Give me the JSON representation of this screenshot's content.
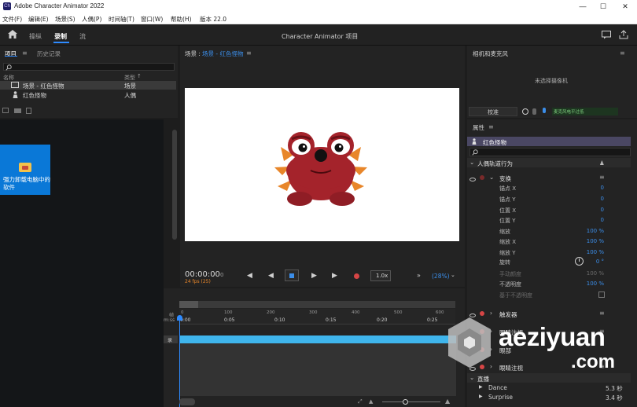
{
  "window": {
    "title": "Adobe Character Animator 2022",
    "icon": "Ch"
  },
  "menu": [
    "文件(F)",
    "编辑(E)",
    "场景(S)",
    "人偶(P)",
    "时间轴(T)",
    "窗口(W)",
    "帮助(H)",
    "版本 22.0"
  ],
  "header": {
    "tabs": [
      "操纵",
      "录制",
      "流"
    ],
    "active_tab": "录制",
    "project_title": "Character Animator 项目"
  },
  "project": {
    "tabs": [
      "项目",
      "历史记录"
    ],
    "col_name": "名称",
    "col_type": "类型",
    "items": [
      {
        "name": "场景 - 红色怪物",
        "type": "场景"
      },
      {
        "name": "红色怪物",
        "type": "人偶"
      }
    ]
  },
  "desktop": {
    "label": "强力卸载电脑中的软件"
  },
  "scene": {
    "title_prefix": "场景 : ",
    "title_name": "场景 - 红色怪物",
    "timecode": "00:00:00",
    "frame": "0",
    "fps": "24 fps (25)",
    "speed": "1.0x",
    "zoom": "(28%)"
  },
  "timeline": {
    "frames_label": "帧",
    "secs_label": "m:ss",
    "frame_ticks": [
      "0",
      "100",
      "200",
      "300",
      "400",
      "500",
      "600"
    ],
    "time_ticks": [
      "0:00",
      "0:05",
      "0:10",
      "0:15",
      "0:20",
      "0:25"
    ],
    "track_label": "录"
  },
  "camera": {
    "title": "相机和麦克风",
    "status": "未选择摄像机",
    "calibrate": "校准",
    "mic_status": "麦克风电平过低"
  },
  "properties": {
    "title": "属性",
    "puppet": "红色怪物",
    "section": "人偶轨道行为",
    "transform": "变换",
    "rows": [
      {
        "label": "锚点 X",
        "value": "0"
      },
      {
        "label": "锚点 Y",
        "value": "0"
      },
      {
        "label": "位置 X",
        "value": "0"
      },
      {
        "label": "位置 Y",
        "value": "0"
      },
      {
        "label": "缩放",
        "value": "100 %"
      },
      {
        "label": "缩放 X",
        "value": "100 %"
      },
      {
        "label": "缩放 Y",
        "value": "100 %"
      },
      {
        "label": "旋转",
        "value": "0 °"
      },
      {
        "label": "手动颜度",
        "value": "100 %"
      },
      {
        "label": "不透明度",
        "value": "100 %"
      },
      {
        "label": "基于不透明度",
        "value": ""
      }
    ],
    "behaviors": [
      "触发器",
      "眼睛注视",
      "眼部",
      "眼睛注视"
    ],
    "live_title": "直播",
    "live": [
      {
        "name": "Dance",
        "value": "5.3 秒"
      },
      {
        "name": "Surprise",
        "value": "3.4 秒"
      }
    ]
  },
  "watermark": {
    "brand": "aeziyuan",
    "domain": ".com"
  },
  "colors": {
    "accent": "#2e8bff",
    "track": "#3fb5ec",
    "record": "#d64545",
    "puppet_body": "#a4232b",
    "spikes": "#e8862a"
  }
}
